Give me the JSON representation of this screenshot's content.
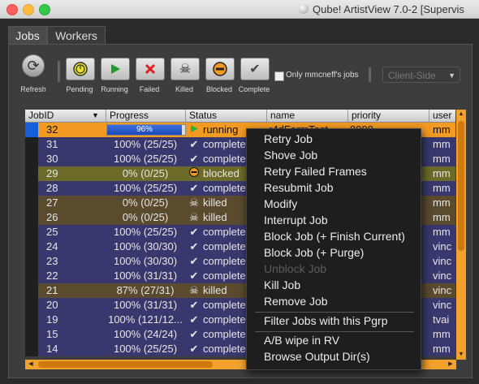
{
  "window": {
    "title": "Qube! ArtistView 7.0-2 [Supervis"
  },
  "tabs": [
    {
      "label": "Jobs"
    },
    {
      "label": "Workers"
    }
  ],
  "toolbar": {
    "refresh_label": "Refresh",
    "filters": [
      {
        "label": "Pending",
        "icon": "pending-icon"
      },
      {
        "label": "Running",
        "icon": "play-icon"
      },
      {
        "label": "Failed",
        "icon": "x-icon"
      },
      {
        "label": "Killed",
        "icon": "skull-icon"
      },
      {
        "label": "Blocked",
        "icon": "blocked-icon"
      },
      {
        "label": "Complete",
        "icon": "check-icon"
      }
    ],
    "only_mine_label": "Only mmcneff's jobs",
    "only_mine_checked": false,
    "client_select": "Client-Side"
  },
  "columns": [
    "JobID",
    "Progress",
    "Status",
    "name",
    "priority",
    "user"
  ],
  "rows": [
    {
      "id": "32",
      "progress": "96%",
      "percent": 96,
      "status": "running",
      "name": "r4dFarmTest",
      "priority": "9999",
      "user": "mm",
      "kind": "selected"
    },
    {
      "id": "31",
      "progress": "100% (25/25)",
      "status": "complete",
      "name": "",
      "priority": "",
      "user": "mm",
      "kind": "complete"
    },
    {
      "id": "30",
      "progress": "100% (25/25)",
      "status": "complete",
      "name": "",
      "priority": "",
      "user": "mm",
      "kind": "complete"
    },
    {
      "id": "29",
      "progress": "0% (0/25)",
      "status": "blocked",
      "name": "",
      "priority": "",
      "user": "mm",
      "kind": "blocked"
    },
    {
      "id": "28",
      "progress": "100% (25/25)",
      "status": "complete",
      "name": "",
      "priority": "",
      "user": "mm",
      "kind": "complete"
    },
    {
      "id": "27",
      "progress": "0% (0/25)",
      "status": "killed",
      "name": "",
      "priority": "",
      "user": "mm",
      "kind": "killed"
    },
    {
      "id": "26",
      "progress": "0% (0/25)",
      "status": "killed",
      "name": "",
      "priority": "",
      "user": "mm",
      "kind": "killed"
    },
    {
      "id": "25",
      "progress": "100% (25/25)",
      "status": "complete",
      "name": "",
      "priority": "",
      "user": "mm",
      "kind": "complete"
    },
    {
      "id": "24",
      "progress": "100% (30/30)",
      "status": "complete",
      "name": "",
      "priority": "",
      "user": "vinc",
      "kind": "complete"
    },
    {
      "id": "23",
      "progress": "100% (30/30)",
      "status": "complete",
      "name": "",
      "priority": "",
      "user": "vinc",
      "kind": "complete"
    },
    {
      "id": "22",
      "progress": "100% (31/31)",
      "status": "complete",
      "name": "",
      "priority": "",
      "user": "vinc",
      "kind": "complete"
    },
    {
      "id": "21",
      "progress": "87% (27/31)",
      "status": "killed",
      "name": "",
      "priority": "",
      "user": "vinc",
      "kind": "killed"
    },
    {
      "id": "20",
      "progress": "100% (31/31)",
      "status": "complete",
      "name": "",
      "priority": "",
      "user": "vinc",
      "kind": "complete"
    },
    {
      "id": "19",
      "progress": "100% (121/12...",
      "status": "complete",
      "name": "",
      "priority": "",
      "user": "tvai",
      "kind": "complete"
    },
    {
      "id": "15",
      "progress": "100% (24/24)",
      "status": "complete",
      "name": "",
      "priority": "",
      "user": "mm",
      "kind": "complete"
    },
    {
      "id": "14",
      "progress": "100% (25/25)",
      "status": "complete",
      "name": "",
      "priority": "",
      "user": "mm",
      "kind": "complete"
    }
  ],
  "context_menu": [
    {
      "label": "Retry Job",
      "enabled": true
    },
    {
      "label": "Shove Job",
      "enabled": true
    },
    {
      "label": "Retry Failed Frames",
      "enabled": true
    },
    {
      "label": "Resubmit Job",
      "enabled": true
    },
    {
      "label": "Modify",
      "enabled": true
    },
    {
      "label": "Interrupt Job",
      "enabled": true
    },
    {
      "label": "Block Job (+ Finish Current)",
      "enabled": true
    },
    {
      "label": "Block Job (+ Purge)",
      "enabled": true
    },
    {
      "label": "Unblock Job",
      "enabled": false
    },
    {
      "label": "Kill Job",
      "enabled": true
    },
    {
      "label": "Remove Job",
      "enabled": true
    },
    {
      "label": "Filter Jobs with this Pgrp",
      "enabled": true,
      "separator_before": true
    },
    {
      "label": "A/B wipe in RV",
      "enabled": true,
      "separator_before": true
    },
    {
      "label": "Browse Output Dir(s)",
      "enabled": true
    }
  ],
  "colors": {
    "selected_row": "#f29a22",
    "complete_row": "#38386e",
    "killed_row": "#5a4a2e",
    "blocked_row": "#6c6b2a",
    "scrollbar": "#f2a12c"
  }
}
